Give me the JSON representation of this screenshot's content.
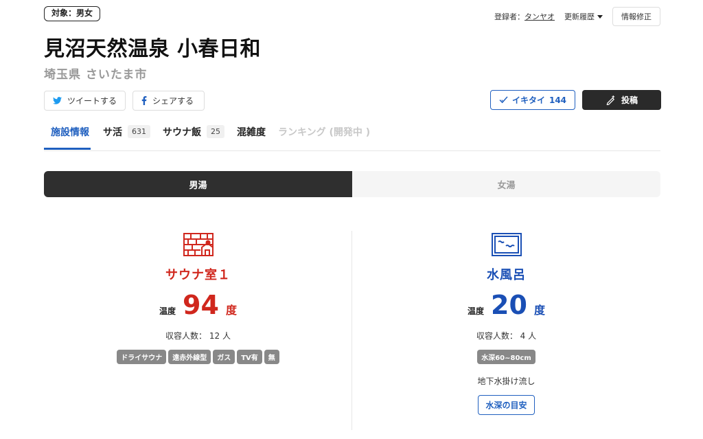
{
  "header": {
    "target_badge": "対象：男女",
    "registrant_label": "登録者：",
    "registrant_name": "タンヤオ",
    "history_label": "更新履歴",
    "edit_label": "情報修正",
    "title": "見沼天然温泉 小春日和",
    "location": "埼玉県 さいたま市"
  },
  "actions": {
    "tweet_label": "ツイートする",
    "share_label": "シェアする",
    "ikitai_label": "イキタイ",
    "ikitai_count": "144",
    "post_label": "投稿"
  },
  "tabs": [
    {
      "label": "施設情報",
      "count": "",
      "state": "active"
    },
    {
      "label": "サ活",
      "count": "631",
      "state": "normal"
    },
    {
      "label": "サウナ飯",
      "count": "25",
      "state": "normal"
    },
    {
      "label": "混雑度",
      "count": "",
      "state": "normal"
    },
    {
      "label": "ランキング (開発中 )",
      "count": "",
      "state": "disabled"
    }
  ],
  "gender_toggle": {
    "male": "男湯",
    "female": "女湯",
    "selected": "男湯"
  },
  "sauna": {
    "icon": "sauna-room-icon",
    "title": "サウナ室１",
    "temp_label": "温度",
    "temp_value": "94",
    "temp_unit": "度",
    "capacity": "収容人数： 12 人",
    "tags": [
      "ドライサウナ",
      "遠赤外線型",
      "ガス",
      "TV有",
      "無"
    ]
  },
  "cold_bath": {
    "icon": "cold-bath-icon",
    "title": "水風呂",
    "temp_label": "温度",
    "temp_value": "20",
    "temp_unit": "度",
    "capacity": "収容人数： 4 人",
    "tags": [
      "水深60~80cm"
    ],
    "note": "地下水掛け流し",
    "guide_button": "水深の目安"
  },
  "colors": {
    "sauna_red": "#d0271d",
    "water_blue": "#1a4fb5",
    "dark": "#2f2f2f"
  }
}
